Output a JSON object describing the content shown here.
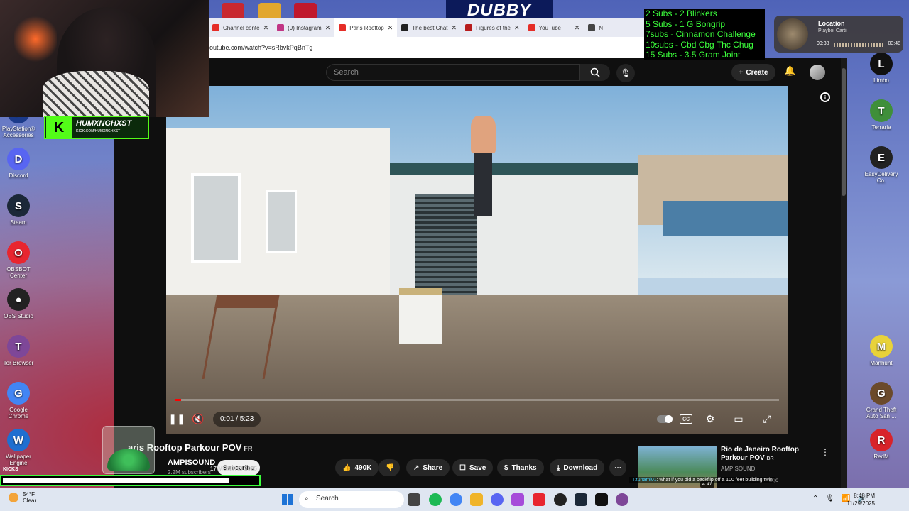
{
  "browser": {
    "tabs": [
      {
        "label": "Channel conte",
        "color": "#e52d27"
      },
      {
        "label": "(9) Instagram",
        "color": "#c13584"
      },
      {
        "label": "Paris Rooftop",
        "color": "#e52d27",
        "active": true
      },
      {
        "label": "The best Chat",
        "color": "#222222"
      },
      {
        "label": "Figures of the",
        "color": "#b71c1c"
      },
      {
        "label": "YouTube",
        "color": "#e52d27"
      },
      {
        "label": "N",
        "color": "#444444"
      }
    ],
    "url": "outube.com/watch?v=sRbvkPqBnTg"
  },
  "youtube": {
    "search_placeholder": "Search",
    "create_label": "Create",
    "video": {
      "title": "aris Rooftop Parkour POV",
      "title_badge": "FR",
      "channel": "AMPISOUND",
      "subscribers": "2.2M subscribers",
      "subscribe_label": "Subscribe",
      "time": "0:01 / 5:23",
      "progress": 0.003
    },
    "actions": {
      "likes": "490K",
      "share": "Share",
      "save": "Save",
      "thanks": "Thanks",
      "download": "Download"
    },
    "recommended": {
      "title": "Rio de Janeiro Rooftop Parkour POV",
      "badge": "BR",
      "channel": "AMPISOUND",
      "time_ago": "ago",
      "duration": "4:47"
    }
  },
  "overlay": {
    "streamer_name": "HUMXNGHXST",
    "streamer_url": "KICK.COM/HUMXNGHXST",
    "dubby": "DUBBY",
    "sub_goals": [
      "2 Subs - 2 Blinkers",
      "5 Subs - 1 G Bongrip",
      "7subs - Cinnamon Challenge",
      "10subs - Cbd Cbg Thc Chug",
      "15 Subs - 3.5 Gram Joint"
    ],
    "music": {
      "label": "Location",
      "artist": "Playboi Carti",
      "elapsed": "00:38",
      "total": "03:48"
    },
    "kicks_label": "KICKS",
    "sub_goal_progress": 0.89,
    "recording_timestamp": "17 MONTHS 2025",
    "chat_user": "Tzunami01",
    "chat_text": ": what if you did a backflip off a 100 feet building twin"
  },
  "desktop": {
    "left_icons": [
      {
        "label": "PlayStation® Accessories",
        "glyph": "P",
        "color": "#1b3a8a"
      },
      {
        "label": "Discord",
        "glyph": "D",
        "color": "#5865f2"
      },
      {
        "label": "Steam",
        "glyph": "S",
        "color": "#1b2838"
      },
      {
        "label": "OBSBOT Center",
        "glyph": "O",
        "color": "#e8262f"
      },
      {
        "label": "OBS Studio",
        "glyph": "●",
        "color": "#222222"
      },
      {
        "label": "Tor Browser",
        "glyph": "T",
        "color": "#7e4798"
      },
      {
        "label": "Google Chrome",
        "glyph": "G",
        "color": "#4285f4"
      },
      {
        "label": "Wallpaper Engine",
        "glyph": "W",
        "color": "#1f6fd0"
      }
    ],
    "right_icons": [
      {
        "label": "Limbo",
        "glyph": "L",
        "color": "#111111"
      },
      {
        "label": "Terraria",
        "glyph": "T",
        "color": "#3f8f3a"
      },
      {
        "label": "EasyDelivery Co.",
        "glyph": "E",
        "color": "#222222"
      },
      {
        "label": "Manhunt",
        "glyph": "M",
        "color": "#e8d23a"
      },
      {
        "label": "Grand Theft Auto San ...",
        "glyph": "G",
        "color": "#6b4a2a"
      },
      {
        "label": "RedM",
        "glyph": "R",
        "color": "#d8232a"
      }
    ]
  },
  "taskbar": {
    "weather_temp": "54°F",
    "weather_desc": "Clear",
    "search_label": "Search",
    "time": "8:48 PM",
    "date": "11/29/2025"
  }
}
